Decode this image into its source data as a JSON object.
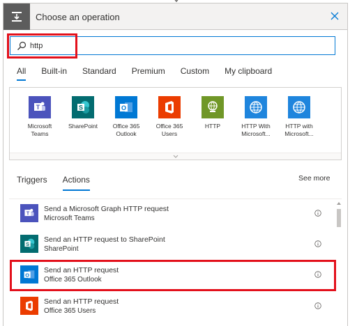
{
  "header": {
    "title": "Choose an operation",
    "icon": "trigger-icon"
  },
  "search": {
    "value": "http",
    "placeholder": ""
  },
  "tabs": [
    {
      "label": "All",
      "active": true
    },
    {
      "label": "Built-in"
    },
    {
      "label": "Standard"
    },
    {
      "label": "Premium"
    },
    {
      "label": "Custom"
    },
    {
      "label": "My clipboard"
    }
  ],
  "connectors": [
    {
      "label": "Microsoft Teams",
      "color": "#4b53bc",
      "icon": "teams-icon"
    },
    {
      "label": "SharePoint",
      "color": "#036c70",
      "icon": "sharepoint-icon"
    },
    {
      "label": "Office 365 Outlook",
      "color": "#0078d4",
      "icon": "outlook-icon"
    },
    {
      "label": "Office 365 Users",
      "color": "#eb3c00",
      "icon": "office-icon"
    },
    {
      "label": "HTTP",
      "color": "#709727",
      "icon": "http-icon"
    },
    {
      "label": "HTTP With Microsoft...",
      "color": "#1f85dd",
      "icon": "globe-icon"
    },
    {
      "label": "HTTP with Microsoft...",
      "color": "#1f85dd",
      "icon": "globe-icon"
    }
  ],
  "sub_tabs": {
    "triggers": "Triggers",
    "actions": "Actions",
    "see_more": "See more"
  },
  "actions": [
    {
      "title": "Send a Microsoft Graph HTTP request",
      "connector": "Microsoft Teams",
      "color": "#4b53bc",
      "icon": "teams-icon"
    },
    {
      "title": "Send an HTTP request to SharePoint",
      "connector": "SharePoint",
      "color": "#036c70",
      "icon": "sharepoint-icon"
    },
    {
      "title": "Send an HTTP request",
      "connector": "Office 365 Outlook",
      "color": "#0078d4",
      "icon": "outlook-icon"
    },
    {
      "title": "Send an HTTP request",
      "connector": "Office 365 Users",
      "color": "#eb3c00",
      "icon": "office-icon"
    }
  ],
  "colors": {
    "accent": "#0078d4",
    "highlight": "#e3101b"
  }
}
